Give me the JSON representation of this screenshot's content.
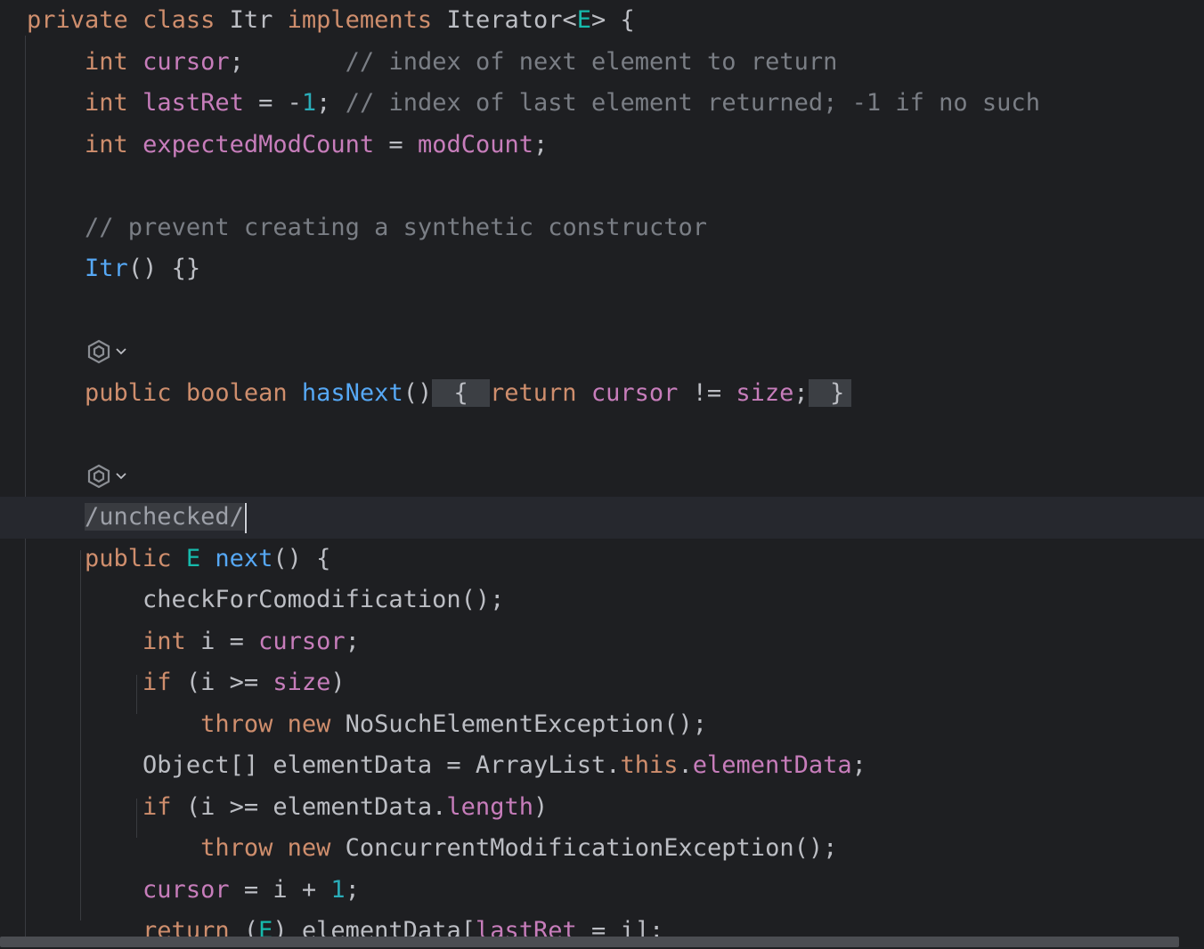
{
  "editor": {
    "language": "Java",
    "lines": [
      {
        "indent": "",
        "tokens": [
          {
            "t": "private",
            "c": "kw"
          },
          {
            "t": " ",
            "c": "plain"
          },
          {
            "t": "class",
            "c": "kw"
          },
          {
            "t": " Itr ",
            "c": "plain"
          },
          {
            "t": "implements",
            "c": "kw"
          },
          {
            "t": " Iterator<",
            "c": "plain"
          },
          {
            "t": "E",
            "c": "tp"
          },
          {
            "t": "> {",
            "c": "plain"
          }
        ]
      },
      {
        "indent": "    ",
        "tokens": [
          {
            "t": "int",
            "c": "kw"
          },
          {
            "t": " ",
            "c": "plain"
          },
          {
            "t": "cursor",
            "c": "fld"
          },
          {
            "t": ";       ",
            "c": "plain"
          },
          {
            "t": "// index of next element to return",
            "c": "cmt"
          }
        ]
      },
      {
        "indent": "    ",
        "tokens": [
          {
            "t": "int",
            "c": "kw"
          },
          {
            "t": " ",
            "c": "plain"
          },
          {
            "t": "lastRet",
            "c": "fld"
          },
          {
            "t": " = -",
            "c": "plain"
          },
          {
            "t": "1",
            "c": "num"
          },
          {
            "t": "; ",
            "c": "plain"
          },
          {
            "t": "// index of last element returned; -1 if no such",
            "c": "cmt"
          }
        ]
      },
      {
        "indent": "    ",
        "tokens": [
          {
            "t": "int",
            "c": "kw"
          },
          {
            "t": " ",
            "c": "plain"
          },
          {
            "t": "expectedModCount",
            "c": "fld"
          },
          {
            "t": " = ",
            "c": "plain"
          },
          {
            "t": "modCount",
            "c": "fld"
          },
          {
            "t": ";",
            "c": "plain"
          }
        ]
      },
      {
        "indent": "",
        "tokens": []
      },
      {
        "indent": "    ",
        "tokens": [
          {
            "t": "// prevent creating a synthetic constructor",
            "c": "cmt"
          }
        ]
      },
      {
        "indent": "    ",
        "tokens": [
          {
            "t": "Itr",
            "c": "fn"
          },
          {
            "t": "() {}",
            "c": "plain"
          }
        ]
      },
      {
        "indent": "",
        "tokens": []
      },
      {
        "indent": "",
        "tokens": [],
        "hint": true
      },
      {
        "indent": "    ",
        "tokens": [
          {
            "t": "public",
            "c": "kw"
          },
          {
            "t": " ",
            "c": "plain"
          },
          {
            "t": "boolean",
            "c": "kw"
          },
          {
            "t": " ",
            "c": "plain"
          },
          {
            "t": "hasNext",
            "c": "fn"
          },
          {
            "t": "()",
            "c": "plain"
          },
          {
            "t": " { ",
            "c": "brace-hl"
          },
          {
            "t": "return",
            "c": "kw"
          },
          {
            "t": " ",
            "c": "plain"
          },
          {
            "t": "cursor",
            "c": "fld"
          },
          {
            "t": " != ",
            "c": "plain"
          },
          {
            "t": "size",
            "c": "fld"
          },
          {
            "t": ";",
            "c": "plain"
          },
          {
            "t": " }",
            "c": "brace-hl"
          }
        ]
      },
      {
        "indent": "",
        "tokens": []
      },
      {
        "indent": "",
        "tokens": [],
        "hint": true
      },
      {
        "indent": "    ",
        "current": true,
        "tokens": [
          {
            "t": "/unchecked/",
            "c": "annot-folded"
          }
        ],
        "caret": true
      },
      {
        "indent": "    ",
        "tokens": [
          {
            "t": "public",
            "c": "kw"
          },
          {
            "t": " ",
            "c": "plain"
          },
          {
            "t": "E",
            "c": "tp"
          },
          {
            "t": " ",
            "c": "plain"
          },
          {
            "t": "next",
            "c": "fn"
          },
          {
            "t": "() {",
            "c": "plain"
          }
        ]
      },
      {
        "indent": "        ",
        "tokens": [
          {
            "t": "checkForComodification();",
            "c": "plain"
          }
        ]
      },
      {
        "indent": "        ",
        "tokens": [
          {
            "t": "int",
            "c": "kw"
          },
          {
            "t": " i = ",
            "c": "plain"
          },
          {
            "t": "cursor",
            "c": "fld"
          },
          {
            "t": ";",
            "c": "plain"
          }
        ]
      },
      {
        "indent": "        ",
        "tokens": [
          {
            "t": "if",
            "c": "kw"
          },
          {
            "t": " (i >= ",
            "c": "plain"
          },
          {
            "t": "size",
            "c": "fld"
          },
          {
            "t": ")",
            "c": "plain"
          }
        ]
      },
      {
        "indent": "            ",
        "tokens": [
          {
            "t": "throw",
            "c": "kw"
          },
          {
            "t": " ",
            "c": "plain"
          },
          {
            "t": "new",
            "c": "kw"
          },
          {
            "t": " NoSuchElementException();",
            "c": "plain"
          }
        ]
      },
      {
        "indent": "        ",
        "tokens": [
          {
            "t": "Object[] elementData = ArrayList.",
            "c": "plain"
          },
          {
            "t": "this",
            "c": "kw"
          },
          {
            "t": ".",
            "c": "plain"
          },
          {
            "t": "elementData",
            "c": "fld"
          },
          {
            "t": ";",
            "c": "plain"
          }
        ]
      },
      {
        "indent": "        ",
        "tokens": [
          {
            "t": "if",
            "c": "kw"
          },
          {
            "t": " (i >= elementData.",
            "c": "plain"
          },
          {
            "t": "length",
            "c": "fld"
          },
          {
            "t": ")",
            "c": "plain"
          }
        ]
      },
      {
        "indent": "            ",
        "tokens": [
          {
            "t": "throw",
            "c": "kw"
          },
          {
            "t": " ",
            "c": "plain"
          },
          {
            "t": "new",
            "c": "kw"
          },
          {
            "t": " ConcurrentModificationException();",
            "c": "plain"
          }
        ]
      },
      {
        "indent": "        ",
        "tokens": [
          {
            "t": "cursor",
            "c": "fld"
          },
          {
            "t": " = i + ",
            "c": "plain"
          },
          {
            "t": "1",
            "c": "num"
          },
          {
            "t": ";",
            "c": "plain"
          }
        ]
      },
      {
        "indent": "        ",
        "tokens": [
          {
            "t": "return",
            "c": "kw"
          },
          {
            "t": " (",
            "c": "plain"
          },
          {
            "t": "E",
            "c": "tp"
          },
          {
            "t": ") elementData[",
            "c": "plain"
          },
          {
            "t": "lastRet",
            "c": "fld"
          },
          {
            "t": " = i];",
            "c": "plain"
          }
        ]
      },
      {
        "indent": "    ",
        "tokens": [
          {
            "t": "}",
            "c": "plain"
          }
        ]
      }
    ]
  },
  "icons": {
    "ai_hint": "ai-assistant-icon",
    "chevron": "chevron-down-icon"
  },
  "colors": {
    "background": "#1e1f22",
    "keyword": "#cf8e6d",
    "field": "#c77dbb",
    "number": "#2aacb8",
    "comment": "#7a7e85",
    "function": "#56a8f5",
    "type_param": "#16baac",
    "text": "#bcbec4"
  }
}
